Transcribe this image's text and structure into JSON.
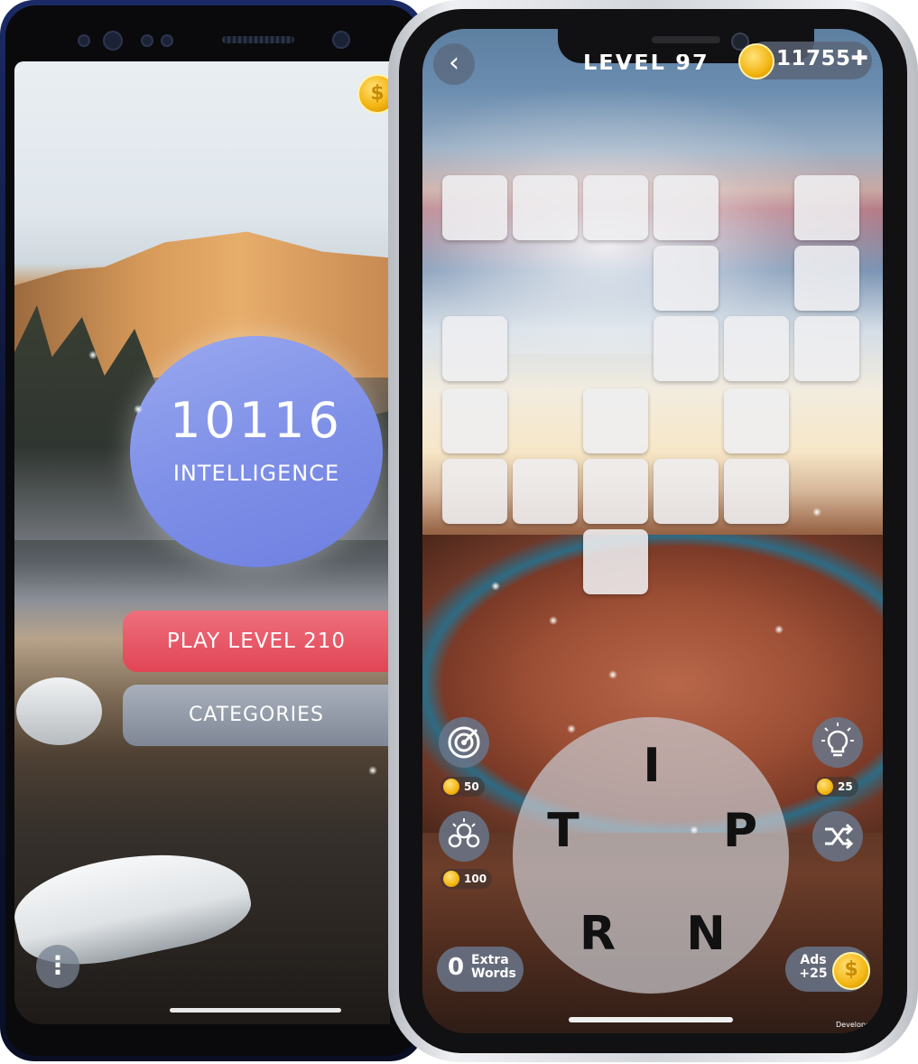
{
  "android": {
    "iq_value": "10116",
    "iq_label": "INTELLIGENCE",
    "play_label": "PLAY LEVEL 210",
    "categories_label": "CATEGORIES",
    "menu_icon": "⋮",
    "coin_symbol": "$"
  },
  "iphone": {
    "back_icon": "‹",
    "level_title": "LEVEL 97",
    "coins": "11755✚",
    "wheel_letters": [
      "I",
      "T",
      "P",
      "R",
      "N"
    ],
    "target_cost": "50",
    "hint_cost": "25",
    "multi_hint_cost": "100",
    "extra_words_count": "0",
    "extra_words_label": "Extra Words",
    "ads_label": "Ads +25",
    "ads_coin_symbol": "$",
    "developer_text": "Develope"
  },
  "colors": {
    "play_button": "#e14556",
    "categories_button": "#7f8796",
    "iq_circle": "#7f90e8",
    "coin": "#f3b512"
  }
}
